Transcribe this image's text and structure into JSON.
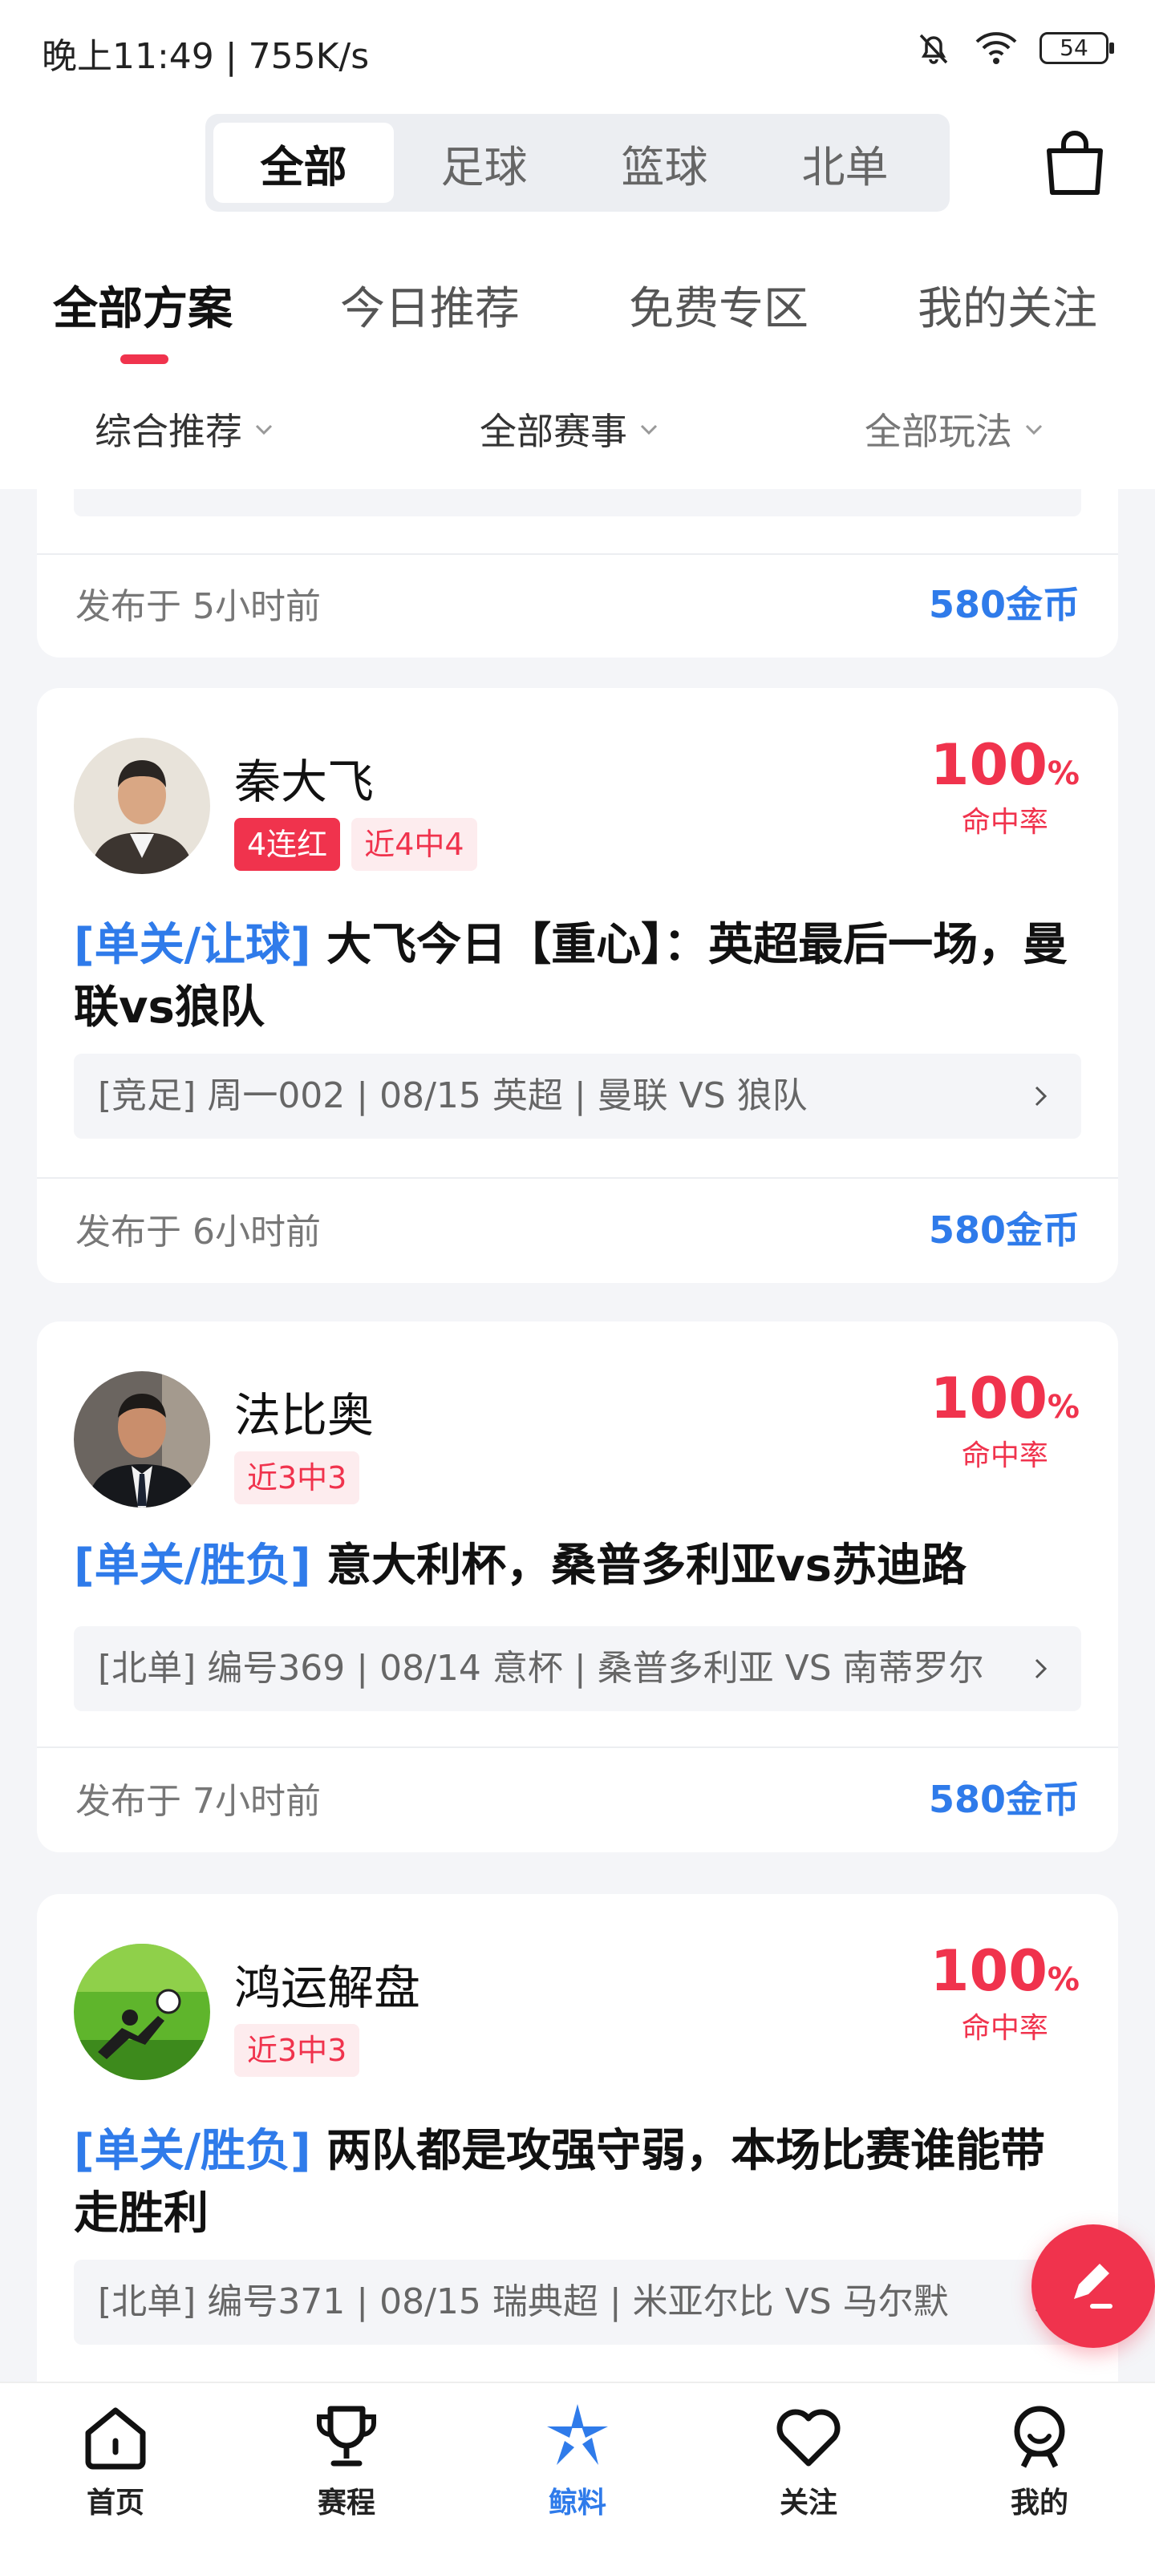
{
  "status_bar": {
    "time": "晚上11:49 | 755K/s",
    "battery": "54"
  },
  "header": {
    "segments": [
      {
        "label": "全部",
        "active": true
      },
      {
        "label": "足球",
        "active": false
      },
      {
        "label": "篮球",
        "active": false
      },
      {
        "label": "北单",
        "active": false
      }
    ],
    "bag_icon": "shopping-bag-icon"
  },
  "tabs": [
    {
      "label": "全部方案",
      "active": true
    },
    {
      "label": "今日推荐",
      "active": false
    },
    {
      "label": "免费专区",
      "active": false
    },
    {
      "label": "我的关注",
      "active": false
    }
  ],
  "filters": [
    {
      "label": "综合推荐"
    },
    {
      "label": "全部赛事"
    },
    {
      "label": "全部玩法"
    }
  ],
  "partial_card": {
    "published": "发布于 5小时前",
    "price": "580金币"
  },
  "cards": [
    {
      "author": "秦大飞",
      "badges": [
        {
          "text": "4连红",
          "style": "red"
        },
        {
          "text": "近4中4",
          "style": "pink"
        }
      ],
      "rate": "100",
      "rate_unit": "%",
      "rate_label": "命中率",
      "tag": "[单关/让球]",
      "title": "大飞今日【重心】：英超最后一场，曼联vs狼队",
      "match": "[竞足] 周一002 | 08/15 英超 | 曼联 VS 狼队",
      "published": "发布于 6小时前",
      "price": "580金币"
    },
    {
      "author": "法比奥",
      "badges": [
        {
          "text": "近3中3",
          "style": "pink"
        }
      ],
      "rate": "100",
      "rate_unit": "%",
      "rate_label": "命中率",
      "tag": "[单关/胜负]",
      "title": "意大利杯，桑普多利亚vs苏迪路",
      "match": "[北单] 编号369 | 08/14 意杯 | 桑普多利亚 VS 南蒂罗尔",
      "published": "发布于 7小时前",
      "price": "580金币"
    },
    {
      "author": "鸿运解盘",
      "badges": [
        {
          "text": "近3中3",
          "style": "pink"
        }
      ],
      "rate": "100",
      "rate_unit": "%",
      "rate_label": "命中率",
      "tag": "[单关/胜负]",
      "title": "两队都是攻强守弱，本场比赛谁能带走胜利",
      "match": "[北单] 编号371 | 08/15 瑞典超 | 米亚尔比 VS 马尔默",
      "published": "",
      "price": ""
    }
  ],
  "bottom_nav": [
    {
      "label": "首页",
      "icon": "home-icon",
      "active": false
    },
    {
      "label": "赛程",
      "icon": "trophy-icon",
      "active": false
    },
    {
      "label": "鲸料",
      "icon": "pinwheel-icon",
      "active": true
    },
    {
      "label": "关注",
      "icon": "heart-icon",
      "active": false
    },
    {
      "label": "我的",
      "icon": "profile-icon",
      "active": false
    }
  ],
  "colors": {
    "accent_red": "#f0334d",
    "accent_blue": "#2f7bea"
  }
}
